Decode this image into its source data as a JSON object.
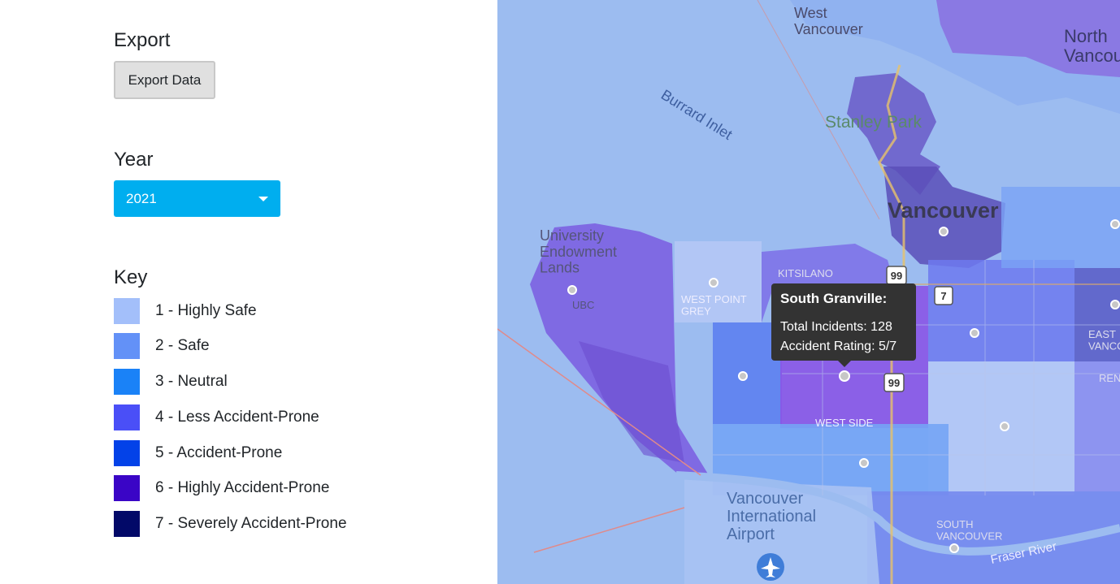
{
  "export": {
    "title": "Export",
    "button_label": "Export Data"
  },
  "year": {
    "title": "Year",
    "selected": "2021"
  },
  "key": {
    "title": "Key",
    "items": [
      {
        "label": "1 - Highly Safe",
        "color": "#a3bffa"
      },
      {
        "label": "2 - Safe",
        "color": "#6391f7"
      },
      {
        "label": "3 - Neutral",
        "color": "#1a82f7"
      },
      {
        "label": "4 - Less Accident-Prone",
        "color": "#4a4ff7"
      },
      {
        "label": "5 - Accident-Prone",
        "color": "#0342e8"
      },
      {
        "label": "6 - Highly Accident-Prone",
        "color": "#3a05c6"
      },
      {
        "label": "7 - Severely Accident-Prone",
        "color": "#020968"
      }
    ]
  },
  "map": {
    "labels": {
      "west_vancouver": "West\nVancouver",
      "north_vancouver": "North\nVancouve",
      "burrard_inlet": "Burrard Inlet",
      "stanley_park": "Stanley Park",
      "vancouver": "Vancouver",
      "ubc_lands": "University\nEndowment\nLands",
      "ubc": "UBC",
      "west_point_grey": "WEST POINT\nGREY",
      "kitsilano": "KITSILANO",
      "west_side": "WEST SIDE",
      "east_vancouver": "EAST\nVANCOUV",
      "renfrew": "REN",
      "airport": "Vancouver\nInternational\nAirport",
      "south_vancouver": "SOUTH\nVANCOUVER",
      "fraser_river": "Fraser River",
      "hwy_99": "99",
      "hwy_7": "7"
    },
    "tooltip": {
      "title": "South Granville:",
      "incidents": "Total Incidents: 128",
      "rating": "Accident Rating: 5/7"
    }
  }
}
